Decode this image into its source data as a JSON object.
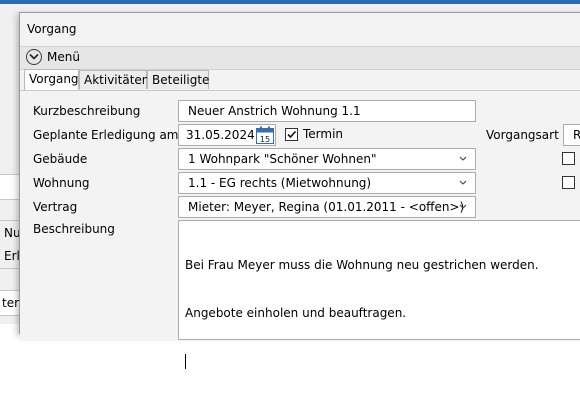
{
  "background": {
    "fields": [
      {
        "text": "Nu"
      },
      {
        "text": "Erle"
      },
      {
        "text": "ter"
      }
    ]
  },
  "dialog": {
    "title": "Vorgang",
    "menu_label": "Menü"
  },
  "tabs": [
    {
      "label": "Vorgang",
      "active": true
    },
    {
      "label": "Aktivitäten",
      "active": false
    },
    {
      "label": "Beteiligte",
      "active": false
    }
  ],
  "form": {
    "kurzbeschreibung": {
      "label": "Kurzbeschreibung",
      "value": "Neuer Anstrich Wohnung 1.1"
    },
    "geplante": {
      "label": "Geplante",
      "label2": "Erledigung am",
      "value": "31.05.2024",
      "calendar_day": "15"
    },
    "termin": {
      "label": "Termin",
      "checked": true
    },
    "vorgangsart": {
      "label": "Vorgangsart",
      "value": "Re"
    },
    "gebaeude": {
      "label": "Gebäude",
      "value": "1 Wohnpark \"Schöner Wohnen\""
    },
    "wohnung": {
      "label": "Wohnung",
      "value": "1.1 - EG rechts (Mietwohnung)"
    },
    "vertrag": {
      "label": "Vertrag",
      "value": "Mieter: Meyer, Regina (01.01.2011 - <offen>)"
    },
    "beschreibung": {
      "label": "Beschreibung",
      "line1": "Bei Frau Meyer muss die Wohnung neu gestrichen werden.",
      "line2": "Angebote einholen und beauftragen."
    }
  },
  "colors": {
    "accent": "#2b6cb3",
    "calendar_blue": "#3a6ea5"
  }
}
